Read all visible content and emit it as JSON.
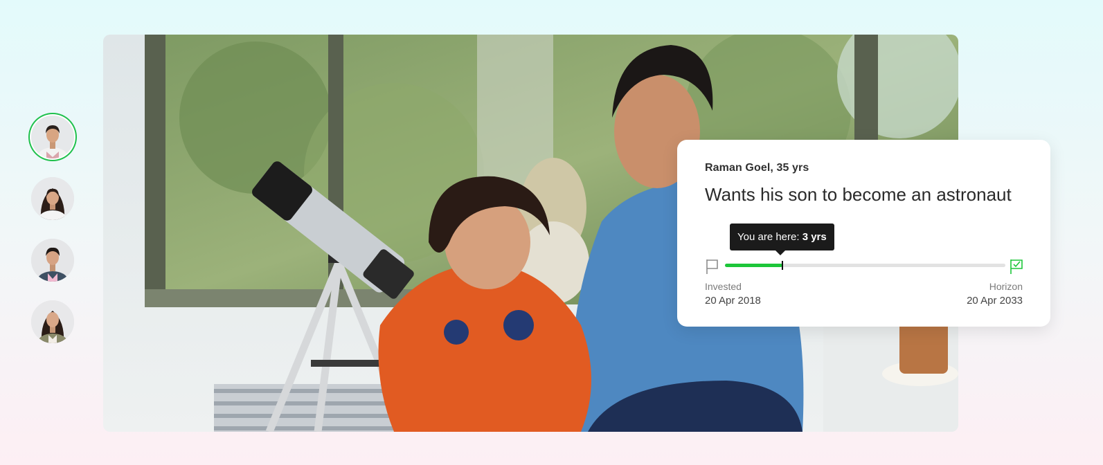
{
  "profiles": [
    {
      "name": "profile-1",
      "active": true
    },
    {
      "name": "profile-2",
      "active": false
    },
    {
      "name": "profile-3",
      "active": false
    },
    {
      "name": "profile-4",
      "active": false
    }
  ],
  "card": {
    "person": "Raman Goel, 35 yrs",
    "goal": "Wants his son to become an astronaut",
    "tooltip_prefix": "You are here: ",
    "tooltip_value": "3 yrs",
    "progress": 0.205,
    "start_label": "Invested",
    "start_date": "20 Apr 2018",
    "end_label": "Horizon",
    "end_date": "20 Apr 2033"
  },
  "colors": {
    "accent": "#1cc639",
    "active_ring": "#1fc04c",
    "tooltip_bg": "#1b1b1b",
    "track": "#e2e2e2"
  },
  "icons": {
    "start": "flag-outline-icon",
    "end": "flag-check-icon"
  }
}
